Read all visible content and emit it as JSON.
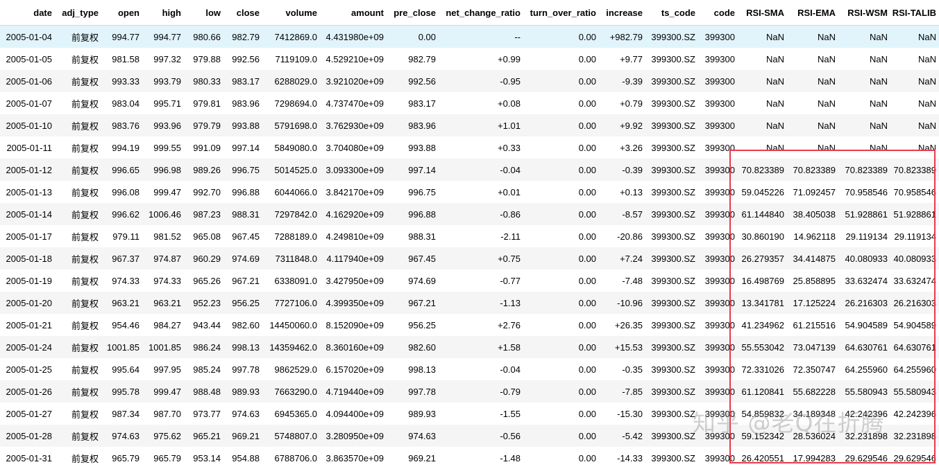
{
  "table": {
    "columns": [
      "date",
      "adj_type",
      "open",
      "high",
      "low",
      "close",
      "volume",
      "amount",
      "pre_close",
      "net_change_ratio",
      "turn_over_ratio",
      "increase",
      "ts_code",
      "code",
      "RSI-SMA",
      "RSI-EMA",
      "RSI-WSM",
      "RSI-TALIB"
    ],
    "rows": [
      [
        "2005-01-04",
        "前复权",
        "994.77",
        "994.77",
        "980.66",
        "982.79",
        "7412869.0",
        "4.431980e+09",
        "0.00",
        "--",
        "0.00",
        "+982.79",
        "399300.SZ",
        "399300",
        "NaN",
        "NaN",
        "NaN",
        "NaN"
      ],
      [
        "2005-01-05",
        "前复权",
        "981.58",
        "997.32",
        "979.88",
        "992.56",
        "7119109.0",
        "4.529210e+09",
        "982.79",
        "+0.99",
        "0.00",
        "+9.77",
        "399300.SZ",
        "399300",
        "NaN",
        "NaN",
        "NaN",
        "NaN"
      ],
      [
        "2005-01-06",
        "前复权",
        "993.33",
        "993.79",
        "980.33",
        "983.17",
        "6288029.0",
        "3.921020e+09",
        "992.56",
        "-0.95",
        "0.00",
        "-9.39",
        "399300.SZ",
        "399300",
        "NaN",
        "NaN",
        "NaN",
        "NaN"
      ],
      [
        "2005-01-07",
        "前复权",
        "983.04",
        "995.71",
        "979.81",
        "983.96",
        "7298694.0",
        "4.737470e+09",
        "983.17",
        "+0.08",
        "0.00",
        "+0.79",
        "399300.SZ",
        "399300",
        "NaN",
        "NaN",
        "NaN",
        "NaN"
      ],
      [
        "2005-01-10",
        "前复权",
        "983.76",
        "993.96",
        "979.79",
        "993.88",
        "5791698.0",
        "3.762930e+09",
        "983.96",
        "+1.01",
        "0.00",
        "+9.92",
        "399300.SZ",
        "399300",
        "NaN",
        "NaN",
        "NaN",
        "NaN"
      ],
      [
        "2005-01-11",
        "前复权",
        "994.19",
        "999.55",
        "991.09",
        "997.14",
        "5849080.0",
        "3.704080e+09",
        "993.88",
        "+0.33",
        "0.00",
        "+3.26",
        "399300.SZ",
        "399300",
        "NaN",
        "NaN",
        "NaN",
        "NaN"
      ],
      [
        "2005-01-12",
        "前复权",
        "996.65",
        "996.98",
        "989.26",
        "996.75",
        "5014525.0",
        "3.093300e+09",
        "997.14",
        "-0.04",
        "0.00",
        "-0.39",
        "399300.SZ",
        "399300",
        "70.823389",
        "70.823389",
        "70.823389",
        "70.823389"
      ],
      [
        "2005-01-13",
        "前复权",
        "996.08",
        "999.47",
        "992.70",
        "996.88",
        "6044066.0",
        "3.842170e+09",
        "996.75",
        "+0.01",
        "0.00",
        "+0.13",
        "399300.SZ",
        "399300",
        "59.045226",
        "71.092457",
        "70.958546",
        "70.958546"
      ],
      [
        "2005-01-14",
        "前复权",
        "996.62",
        "1006.46",
        "987.23",
        "988.31",
        "7297842.0",
        "4.162920e+09",
        "996.88",
        "-0.86",
        "0.00",
        "-8.57",
        "399300.SZ",
        "399300",
        "61.144840",
        "38.405038",
        "51.928861",
        "51.928861"
      ],
      [
        "2005-01-17",
        "前复权",
        "979.11",
        "981.52",
        "965.08",
        "967.45",
        "7288189.0",
        "4.249810e+09",
        "988.31",
        "-2.11",
        "0.00",
        "-20.86",
        "399300.SZ",
        "399300",
        "30.860190",
        "14.962118",
        "29.119134",
        "29.119134"
      ],
      [
        "2005-01-18",
        "前复权",
        "967.37",
        "974.87",
        "960.29",
        "974.69",
        "7311848.0",
        "4.117940e+09",
        "967.45",
        "+0.75",
        "0.00",
        "+7.24",
        "399300.SZ",
        "399300",
        "26.279357",
        "34.414875",
        "40.080933",
        "40.080933"
      ],
      [
        "2005-01-19",
        "前复权",
        "974.33",
        "974.33",
        "965.26",
        "967.21",
        "6338091.0",
        "3.427950e+09",
        "974.69",
        "-0.77",
        "0.00",
        "-7.48",
        "399300.SZ",
        "399300",
        "16.498769",
        "25.858895",
        "33.632474",
        "33.632474"
      ],
      [
        "2005-01-20",
        "前复权",
        "963.21",
        "963.21",
        "952.23",
        "956.25",
        "7727106.0",
        "4.399350e+09",
        "967.21",
        "-1.13",
        "0.00",
        "-10.96",
        "399300.SZ",
        "399300",
        "13.341781",
        "17.125224",
        "26.216303",
        "26.216303"
      ],
      [
        "2005-01-21",
        "前复权",
        "954.46",
        "984.27",
        "943.44",
        "982.60",
        "14450060.0",
        "8.152090e+09",
        "956.25",
        "+2.76",
        "0.00",
        "+26.35",
        "399300.SZ",
        "399300",
        "41.234962",
        "61.215516",
        "54.904589",
        "54.904589"
      ],
      [
        "2005-01-24",
        "前复权",
        "1001.85",
        "1001.85",
        "986.24",
        "998.13",
        "14359462.0",
        "8.360160e+09",
        "982.60",
        "+1.58",
        "0.00",
        "+15.53",
        "399300.SZ",
        "399300",
        "55.553042",
        "73.047139",
        "64.630761",
        "64.630761"
      ],
      [
        "2005-01-25",
        "前复权",
        "995.64",
        "997.95",
        "985.24",
        "997.78",
        "9862529.0",
        "6.157020e+09",
        "998.13",
        "-0.04",
        "0.00",
        "-0.35",
        "399300.SZ",
        "399300",
        "72.331026",
        "72.350747",
        "64.255960",
        "64.255960"
      ],
      [
        "2005-01-26",
        "前复权",
        "995.78",
        "999.47",
        "988.48",
        "989.93",
        "7663290.0",
        "4.719440e+09",
        "997.78",
        "-0.79",
        "0.00",
        "-7.85",
        "399300.SZ",
        "399300",
        "61.120841",
        "55.682228",
        "55.580943",
        "55.580943"
      ],
      [
        "2005-01-27",
        "前复权",
        "987.34",
        "987.70",
        "973.77",
        "974.63",
        "6945365.0",
        "4.094400e+09",
        "989.93",
        "-1.55",
        "0.00",
        "-15.30",
        "399300.SZ",
        "399300",
        "54.859832",
        "34.189348",
        "42.242396",
        "42.242396"
      ],
      [
        "2005-01-28",
        "前复权",
        "974.63",
        "975.62",
        "965.21",
        "969.21",
        "5748807.0",
        "3.280950e+09",
        "974.63",
        "-0.56",
        "0.00",
        "-5.42",
        "399300.SZ",
        "399300",
        "59.152342",
        "28.536024",
        "32.231898",
        "32.231898"
      ],
      [
        "2005-01-31",
        "前复权",
        "965.79",
        "965.79",
        "953.14",
        "954.88",
        "6788706.0",
        "3.863570e+09",
        "969.21",
        "-1.48",
        "0.00",
        "-14.33",
        "399300.SZ",
        "399300",
        "26.420551",
        "17.994283",
        "29.629546",
        "29.629546"
      ]
    ]
  },
  "watermark": "知乎 @老Q在折腾",
  "colors": {
    "highlight_box": "#e8394a",
    "row_stripe": "#f5f5f5",
    "row_hover": "#e1f4fb"
  }
}
